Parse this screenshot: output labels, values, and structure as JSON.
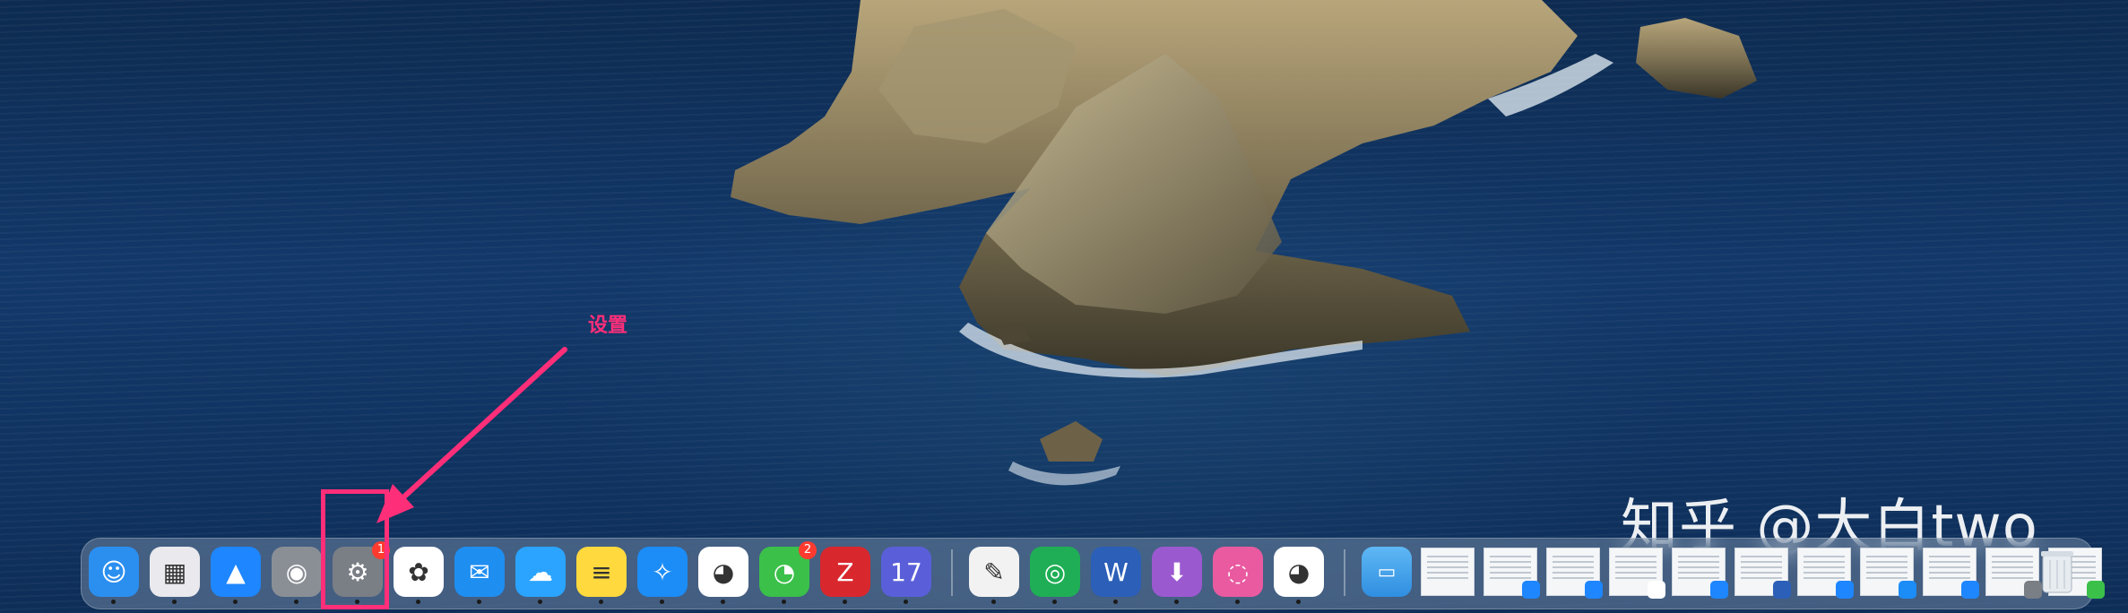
{
  "annotation": {
    "label": "设置",
    "color": "#ff2e79"
  },
  "watermark": {
    "text": "知乎 @大白two"
  },
  "dock": {
    "apps": [
      {
        "name": "finder-icon",
        "glyph": "☺",
        "bg": "#2b8ff0"
      },
      {
        "name": "launchpad-icon",
        "glyph": "▦",
        "bg": "#e9e9ee"
      },
      {
        "name": "app-store-icon",
        "glyph": "▲",
        "bg": "#1e86ff"
      },
      {
        "name": "automator-icon",
        "glyph": "◉",
        "bg": "#8a8f96"
      },
      {
        "name": "system-preferences-icon",
        "glyph": "⚙",
        "bg": "#7a7e85",
        "badge": "1"
      },
      {
        "name": "photos-icon",
        "glyph": "✿",
        "bg": "#ffffff"
      },
      {
        "name": "mail-icon",
        "glyph": "✉",
        "bg": "#1f8ef1"
      },
      {
        "name": "cloud-icon",
        "glyph": "☁",
        "bg": "#2aa4ff"
      },
      {
        "name": "notes-icon",
        "glyph": "≡",
        "bg": "#ffd93d"
      },
      {
        "name": "safari-icon",
        "glyph": "✧",
        "bg": "#1c8cf6"
      },
      {
        "name": "qq-icon",
        "glyph": "◕",
        "bg": "#ffffff"
      },
      {
        "name": "wechat-icon",
        "glyph": "◔",
        "bg": "#3bc04a",
        "badge": "2"
      },
      {
        "name": "zotero-icon",
        "glyph": "Z",
        "bg": "#d9272e"
      },
      {
        "name": "calendar-grid-icon",
        "glyph": "17",
        "bg": "#5a5fd9"
      }
    ],
    "apps2": [
      {
        "name": "textedit-icon",
        "glyph": "✎",
        "bg": "#f2f2f2"
      },
      {
        "name": "camera-shutter-icon",
        "glyph": "◎",
        "bg": "#1fae55"
      },
      {
        "name": "word-icon",
        "glyph": "W",
        "bg": "#2b5fb8"
      },
      {
        "name": "downloader-icon",
        "glyph": "⬇",
        "bg": "#9b59d0"
      },
      {
        "name": "app-cleaner-icon",
        "glyph": "◌",
        "bg": "#e95aa0"
      },
      {
        "name": "qq2-icon",
        "glyph": "◕",
        "bg": "#ffffff"
      }
    ],
    "folder_glyph": "📁"
  }
}
